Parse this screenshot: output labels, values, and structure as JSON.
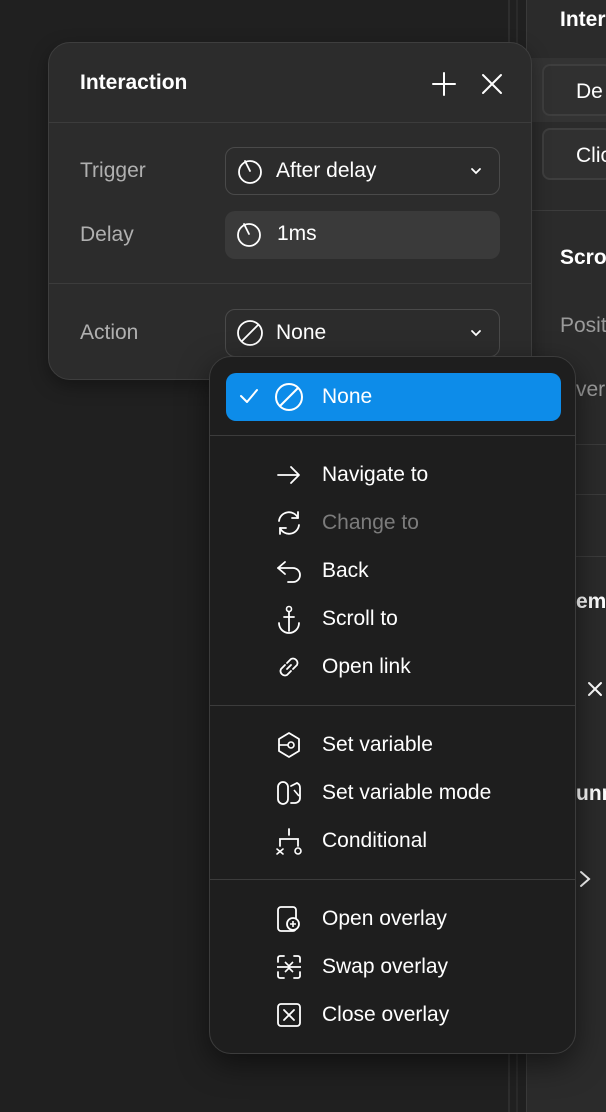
{
  "right_panel": {
    "items": [
      {
        "text": "Inter",
        "bold": true
      },
      {
        "text": "De"
      },
      {
        "text": "Clic"
      },
      {
        "text": "Scro",
        "bold": true
      },
      {
        "text": "Posit",
        "muted": true
      },
      {
        "text": "ver",
        "muted": true
      },
      {
        "text": "em",
        "bold": true
      },
      {
        "text": "unn",
        "bold": true
      }
    ]
  },
  "popover": {
    "title": "Interaction",
    "trigger": {
      "label": "Trigger",
      "value": "After delay"
    },
    "delay": {
      "label": "Delay",
      "value": "1ms"
    },
    "action": {
      "label": "Action",
      "value": "None"
    }
  },
  "menu": {
    "selected": {
      "label": "None"
    },
    "group1": [
      {
        "label": "Navigate to",
        "icon": "arrow-right-icon"
      },
      {
        "label": "Change to",
        "icon": "refresh-icon",
        "disabled": true
      },
      {
        "label": "Back",
        "icon": "back-arrow-icon"
      },
      {
        "label": "Scroll to",
        "icon": "anchor-icon"
      },
      {
        "label": "Open link",
        "icon": "link-icon"
      }
    ],
    "group2": [
      {
        "label": "Set variable",
        "icon": "set-variable-icon"
      },
      {
        "label": "Set variable mode",
        "icon": "variable-mode-icon"
      },
      {
        "label": "Conditional",
        "icon": "conditional-icon"
      }
    ],
    "group3": [
      {
        "label": "Open overlay",
        "icon": "open-overlay-icon"
      },
      {
        "label": "Swap overlay",
        "icon": "swap-overlay-icon"
      },
      {
        "label": "Close overlay",
        "icon": "close-overlay-icon"
      }
    ]
  },
  "colors": {
    "accent": "#0d8ce9",
    "background": "#202020",
    "panel": "#2c2c2c",
    "menu": "#1e1e1e"
  }
}
